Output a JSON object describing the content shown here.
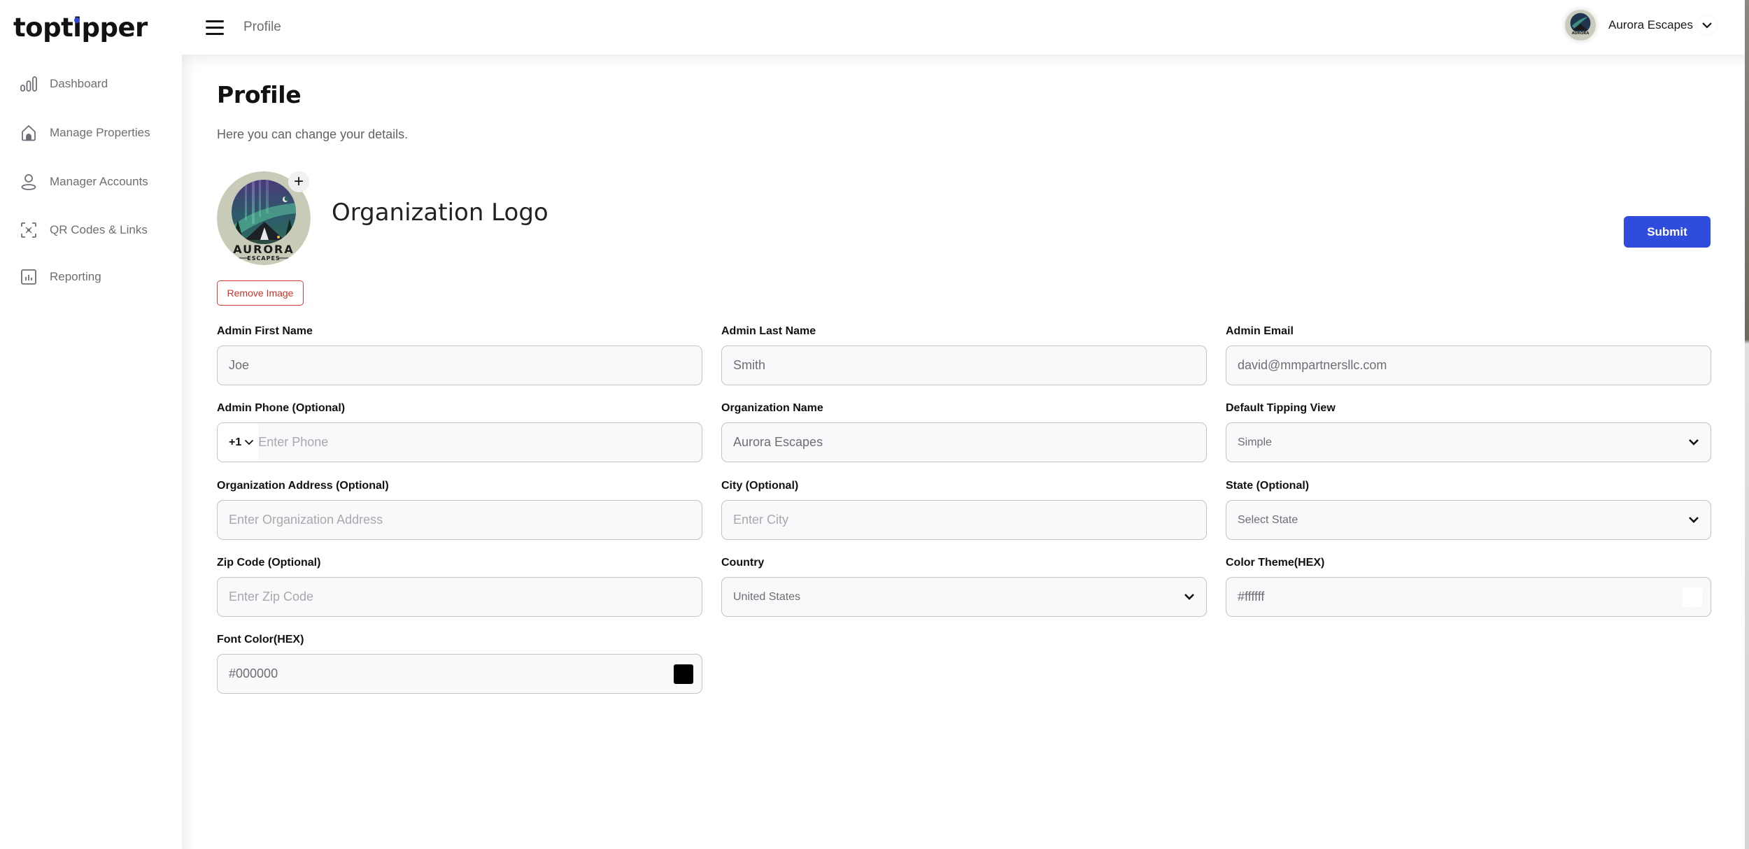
{
  "brand": {
    "name_pre": "topt",
    "name_i": "i",
    "name_post": "pper",
    "accent": "#3047d6"
  },
  "sidebar": {
    "items": [
      {
        "label": "Dashboard",
        "icon": "bar-chart-icon"
      },
      {
        "label": "Manage Properties",
        "icon": "home-icon"
      },
      {
        "label": "Manager Accounts",
        "icon": "user-icon"
      },
      {
        "label": "QR Codes & Links",
        "icon": "qr-scan-icon"
      },
      {
        "label": "Reporting",
        "icon": "report-icon"
      }
    ]
  },
  "header": {
    "breadcrumb": "Profile",
    "user_name": "Aurora Escapes"
  },
  "page": {
    "title": "Profile",
    "subtitle": "Here you can change your details.",
    "logo_title": "Organization Logo",
    "logo_text_main": "AURORA",
    "logo_text_sub": "ESCAPES",
    "add_glyph": "+",
    "remove_image_label": "Remove Image",
    "submit_label": "Submit",
    "submit_color": "#2f4cdd"
  },
  "form": {
    "first_name": {
      "label": "Admin First Name",
      "value": "Joe"
    },
    "last_name": {
      "label": "Admin Last Name",
      "value": "Smith"
    },
    "email": {
      "label": "Admin Email",
      "value": "david@mmpartnersllc.com"
    },
    "phone": {
      "label": "Admin Phone (Optional)",
      "country_code": "+1",
      "placeholder": "Enter Phone"
    },
    "org_name": {
      "label": "Organization Name",
      "value": "Aurora Escapes"
    },
    "tipping_view": {
      "label": "Default Tipping View",
      "value": "Simple"
    },
    "address": {
      "label": "Organization Address (Optional)",
      "placeholder": "Enter Organization Address"
    },
    "city": {
      "label": "City (Optional)",
      "placeholder": "Enter City"
    },
    "state": {
      "label": "State (Optional)",
      "value": "Select State"
    },
    "zip": {
      "label": "Zip Code (Optional)",
      "placeholder": "Enter Zip Code"
    },
    "country": {
      "label": "Country",
      "value": "United States"
    },
    "color_theme": {
      "label": "Color Theme(HEX)",
      "value": "#ffffff",
      "swatch": "#ffffff"
    },
    "font_color": {
      "label": "Font Color(HEX)",
      "value": "#000000",
      "swatch": "#000000"
    }
  }
}
